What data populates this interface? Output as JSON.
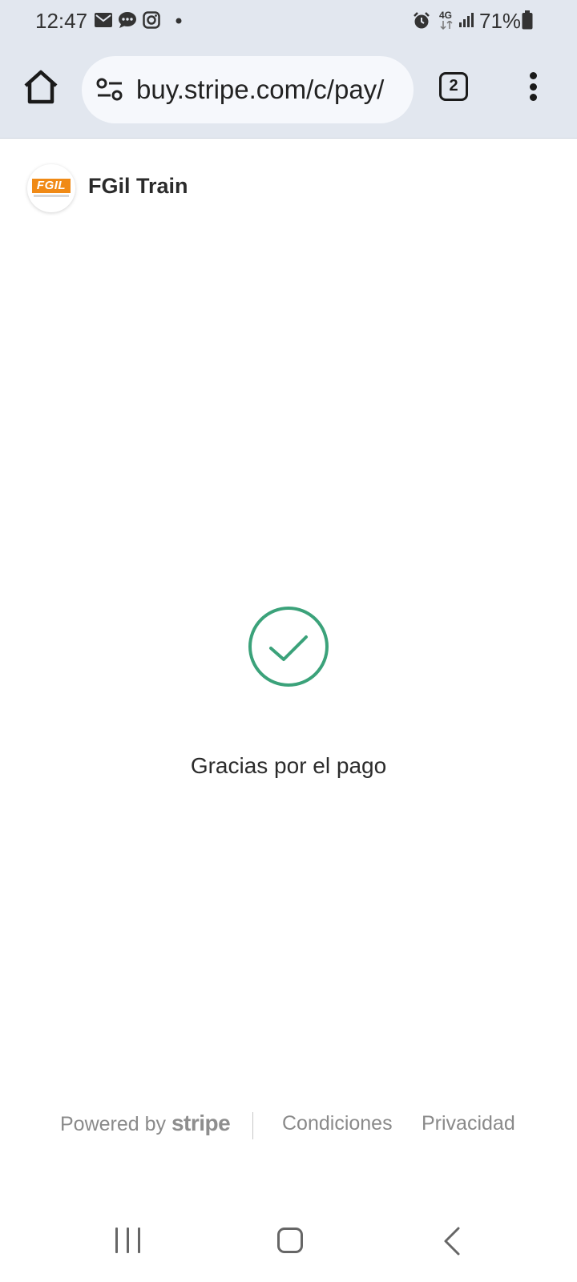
{
  "status_bar": {
    "time": "12:47",
    "left_icons": [
      "mail-icon",
      "chat-icon",
      "instagram-icon",
      "notification-dot-icon"
    ],
    "right_icons": [
      "alarm-icon",
      "network-4g-icon",
      "signal-icon",
      "battery-icon"
    ],
    "network": "4G",
    "battery": "71%"
  },
  "browser": {
    "url": "buy.stripe.com/c/pay/",
    "tab_count": "2"
  },
  "page": {
    "merchant_name": "FGil Train",
    "logo_text": "FGIL",
    "success_message": "Gracias por el pago",
    "accent_color": "#3ba27a"
  },
  "footer": {
    "powered_prefix": "Powered by",
    "powered_brand": "stripe",
    "terms": "Condiciones",
    "privacy": "Privacidad"
  }
}
